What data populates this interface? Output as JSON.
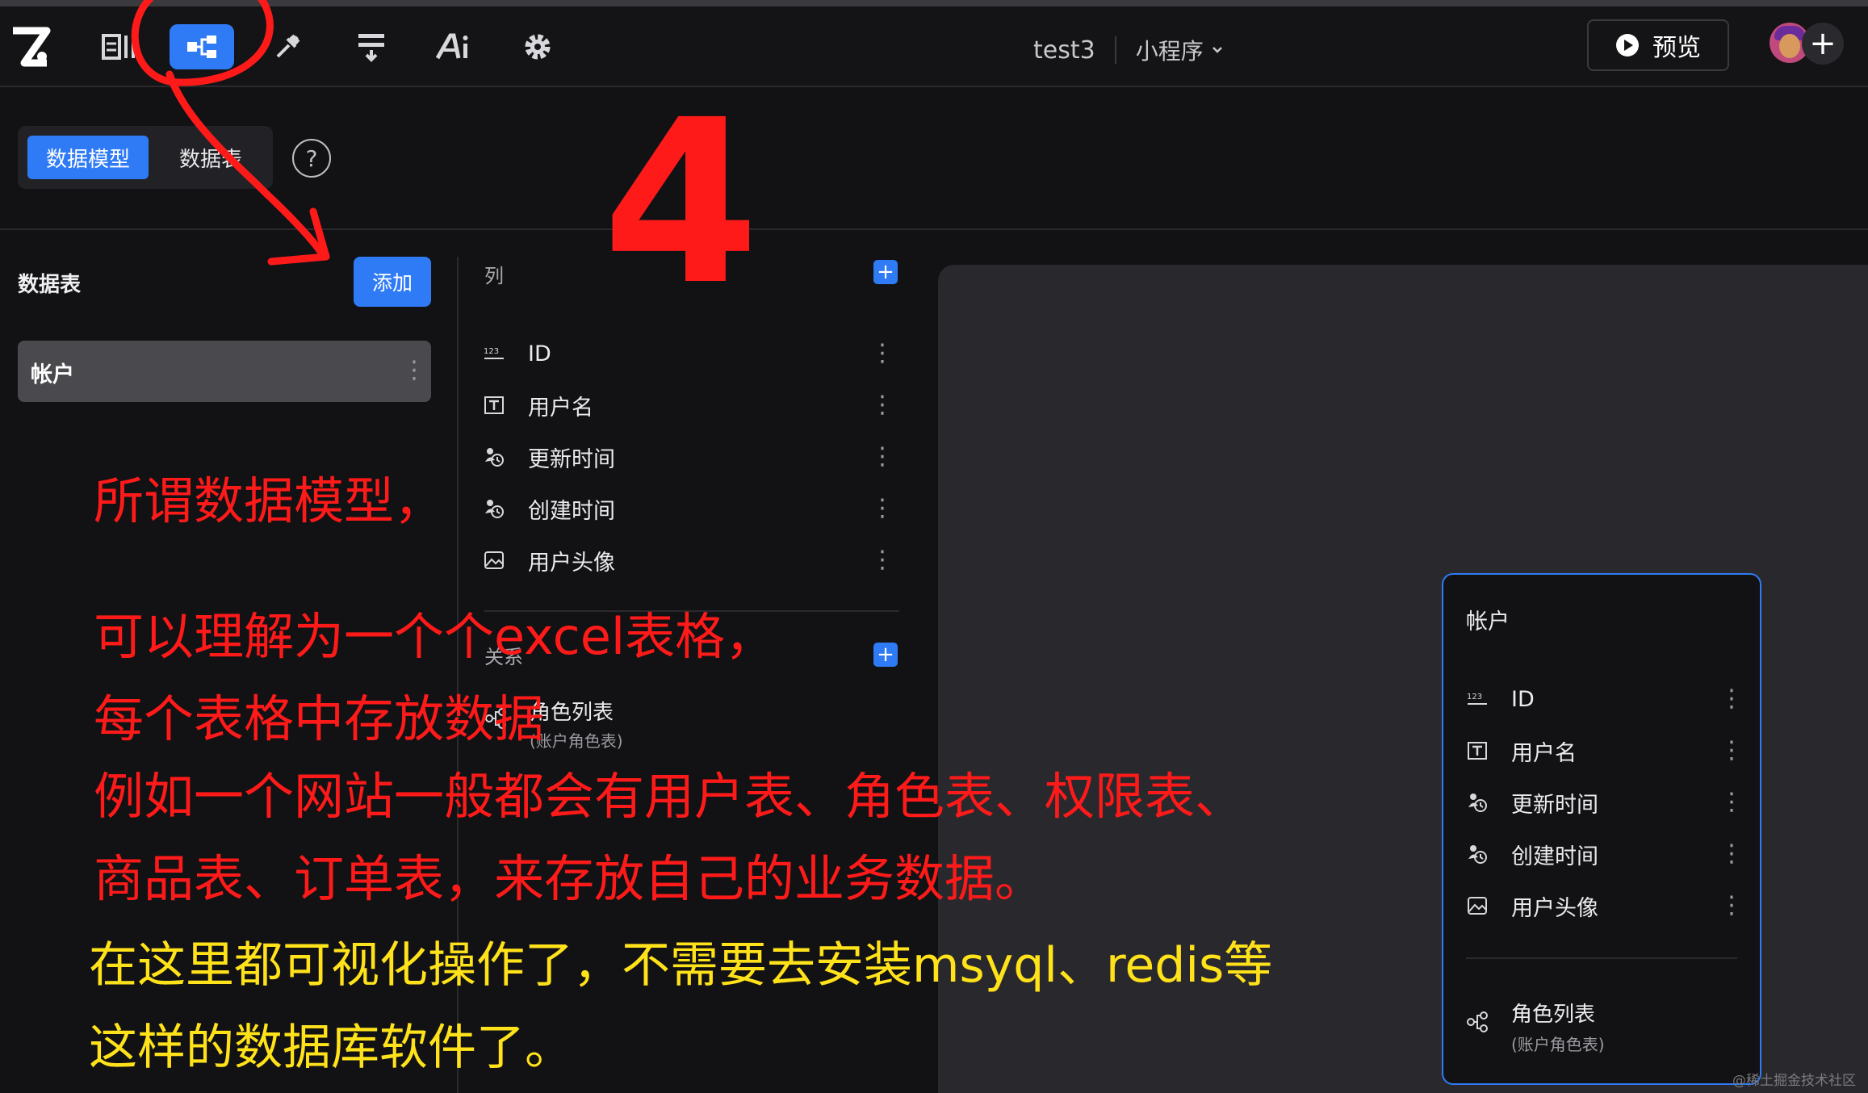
{
  "topbar": {
    "tools": [
      {
        "name": "pages",
        "icon": "pages-icon"
      },
      {
        "name": "data-model",
        "icon": "data-model-icon",
        "active": true
      },
      {
        "name": "logic",
        "icon": "logic-icon"
      },
      {
        "name": "workflow",
        "icon": "workflow-icon"
      },
      {
        "name": "ai",
        "icon": "ai-icon"
      },
      {
        "name": "settings",
        "icon": "gear-icon"
      }
    ],
    "project_name": "test3",
    "app_type": "小程序",
    "preview_label": "预览"
  },
  "tabs": {
    "data_model": "数据模型",
    "data_tables": "数据表"
  },
  "sidebar": {
    "title": "数据表",
    "add_label": "添加",
    "tables": [
      {
        "label": "帐户"
      }
    ]
  },
  "columns": {
    "header": "列",
    "fields": [
      {
        "name": "ID",
        "icon": "number-icon"
      },
      {
        "name": "用户名",
        "icon": "text-icon"
      },
      {
        "name": "更新时间",
        "icon": "datetime-icon"
      },
      {
        "name": "创建时间",
        "icon": "datetime-icon"
      },
      {
        "name": "用户头像",
        "icon": "image-icon"
      }
    ]
  },
  "relations": {
    "header": "关系",
    "items": [
      {
        "name": "角色列表",
        "sub": "(账户角色表)",
        "icon": "relation-icon"
      }
    ]
  },
  "card": {
    "title": "帐户",
    "fields": [
      {
        "name": "ID"
      },
      {
        "name": "用户名"
      },
      {
        "name": "更新时间"
      },
      {
        "name": "创建时间"
      },
      {
        "name": "用户头像"
      }
    ],
    "relation": {
      "name": "角色列表",
      "sub": "(账户角色表)"
    }
  },
  "annotations": {
    "step_number": "4",
    "red_lines": [
      "所谓数据模型，",
      "可以理解为一个个excel表格，",
      "每个表格中存放数据",
      "例如一个网站一般都会有用户表、角色表、权限表、",
      "商品表、订单表，来存放自己的业务数据。"
    ],
    "yellow_lines": [
      "在这里都可视化操作了，不需要去安装msyql、redis等",
      "这样的数据库软件了。"
    ],
    "colors": {
      "red": "#ff1a1a",
      "yellow": "#ffe21a",
      "accent": "#2f7bf5"
    }
  },
  "watermark": "@稀土掘金技术社区"
}
